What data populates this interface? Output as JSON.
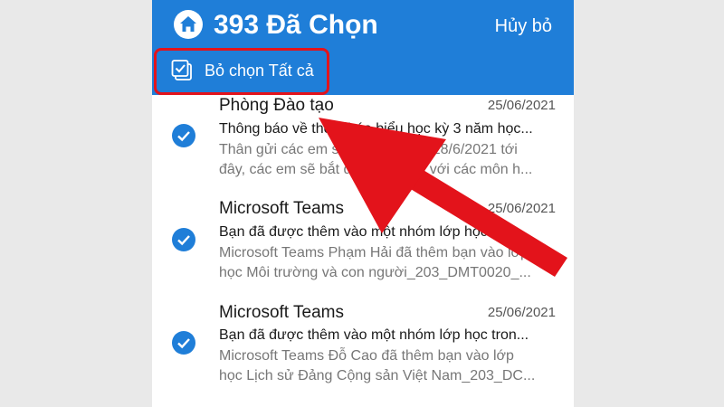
{
  "header": {
    "title": "393 Đã Chọn",
    "cancel_label": "Hủy bỏ",
    "deselect_all_label": "Bỏ chọn Tất cả",
    "home_icon": "home-icon",
    "background_color": "#1f7ed8"
  },
  "messages": [
    {
      "sender": "Phòng Đào tạo",
      "date": "25/06/2021",
      "subject": "Thông báo về thời khóa biểu học kỳ 3 năm học...",
      "preview_line1": "Thân gửi các em sinh viên, ngày 28/6/2021 tới",
      "preview_line2": "đây, các em sẽ bắt đầu học kỳ 3 với các môn h...",
      "selected": true
    },
    {
      "sender": "Microsoft Teams",
      "date": "25/06/2021",
      "subject": "Bạn đã được thêm vào một nhóm lớp học tron...",
      "preview_line1": "Microsoft Teams Phạm Hải đã thêm bạn vào lớp",
      "preview_line2": "học Môi trường và con người_203_DMT0020_...",
      "selected": true
    },
    {
      "sender": "Microsoft Teams",
      "date": "25/06/2021",
      "subject": "Bạn đã được thêm vào một nhóm lớp học tron...",
      "preview_line1": "Microsoft Teams Đỗ Cao đã thêm bạn vào lớp",
      "preview_line2": "học Lịch sử Đảng Cộng sản Việt Nam_203_DC...",
      "selected": true
    }
  ],
  "annotation": {
    "arrow_color": "#e3131b",
    "highlight_color": "#e3131b"
  }
}
